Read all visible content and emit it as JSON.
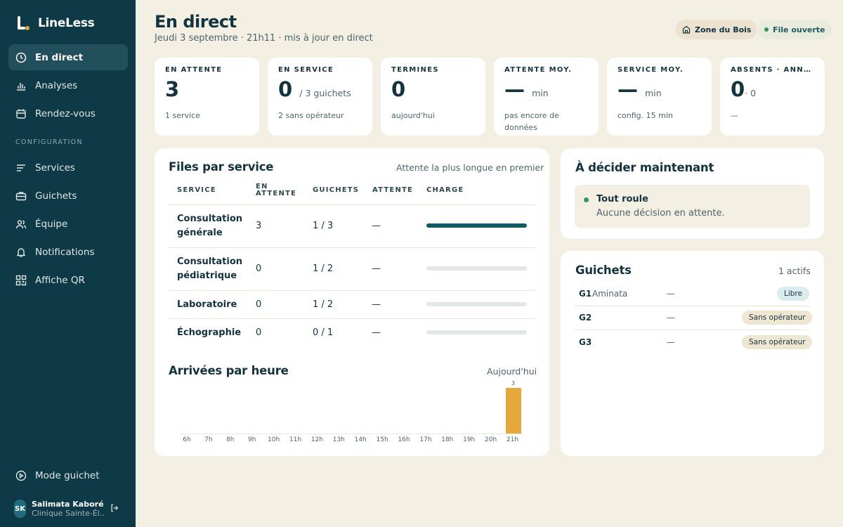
{
  "app": {
    "name": "LineLess"
  },
  "nav": {
    "items": [
      {
        "label": "En direct",
        "icon": "clock-icon"
      },
      {
        "label": "Analyses",
        "icon": "bar-chart-icon"
      },
      {
        "label": "Rendez-vous",
        "icon": "calendar-icon"
      }
    ],
    "section_label": "CONFIGURATION",
    "config_items": [
      {
        "label": "Services",
        "icon": "list-icon"
      },
      {
        "label": "Guichets",
        "icon": "briefcase-icon"
      },
      {
        "label": "Équipe",
        "icon": "users-icon"
      },
      {
        "label": "Notifications",
        "icon": "bell-icon"
      },
      {
        "label": "Affiche QR",
        "icon": "qr-icon"
      }
    ],
    "mode_label": "Mode guichet"
  },
  "user": {
    "initials": "SK",
    "name": "Salimata Kaboré",
    "org": "Clinique Sainte-Él…"
  },
  "header": {
    "title": "En direct",
    "subtitle": "Jeudi 3 septembre · 21h11 · mis à jour en direct",
    "zone_chip": "Zone du Bois",
    "status_chip": "File ouverte"
  },
  "stats": [
    {
      "label": "EN ATTENTE",
      "value": "3",
      "suffix": "",
      "note": "1 service"
    },
    {
      "label": "EN SERVICE",
      "value": "0",
      "suffix": "/ 3 guichets",
      "note": "2 sans opérateur"
    },
    {
      "label": "TERMINÉS",
      "value": "0",
      "suffix": "",
      "note": "aujourd'hui"
    },
    {
      "label": "ATTENTE MOY.",
      "value": "—",
      "suffix": "min",
      "note": "pas encore de données"
    },
    {
      "label": "SERVICE MOY.",
      "value": "—",
      "suffix": "min",
      "note": "config. 15 min"
    },
    {
      "label": "ABSENTS · ANNULÉS",
      "value": "0",
      "suffix": "· 0",
      "note": "—"
    }
  ],
  "queues": {
    "title": "Files par service",
    "sort_note": "Attente la plus longue en premier",
    "columns": [
      "SERVICE",
      "EN ATTENTE",
      "GUICHETS",
      "ATTENTE",
      "CHARGE"
    ],
    "rows": [
      {
        "service": "Consultation générale",
        "waiting": "3",
        "counters": "1 / 3",
        "wait": "—",
        "load": 1.0
      },
      {
        "service": "Consultation pédiatrique",
        "waiting": "0",
        "counters": "1 / 2",
        "wait": "—",
        "load": 0
      },
      {
        "service": "Laboratoire",
        "waiting": "0",
        "counters": "1 / 2",
        "wait": "—",
        "load": 0
      },
      {
        "service": "Échographie",
        "waiting": "0",
        "counters": "0 / 1",
        "wait": "—",
        "load": 0
      }
    ]
  },
  "arrivals": {
    "title": "Arrivées par heure",
    "meta": "Aujourd'hui"
  },
  "chart_data": {
    "type": "bar",
    "title": "Arrivées par heure",
    "categories": [
      "6h",
      "7h",
      "8h",
      "9h",
      "10h",
      "11h",
      "12h",
      "13h",
      "14h",
      "15h",
      "16h",
      "17h",
      "18h",
      "19h",
      "20h",
      "21h"
    ],
    "values": [
      0,
      0,
      0,
      0,
      0,
      0,
      0,
      0,
      0,
      0,
      0,
      0,
      0,
      0,
      0,
      3
    ],
    "ylim": [
      0,
      3
    ],
    "color": "#e4a93a"
  },
  "decide": {
    "title": "À décider maintenant",
    "status_title": "Tout roule",
    "status_text": "Aucune décision en attente."
  },
  "counters": {
    "title": "Guichets",
    "meta": "1 actifs",
    "rows": [
      {
        "id": "G1",
        "name": "Aminata",
        "dash": "—",
        "status": "Libre",
        "kind": "free"
      },
      {
        "id": "G2",
        "name": "",
        "dash": "—",
        "status": "Sans opérateur",
        "kind": "none"
      },
      {
        "id": "G3",
        "name": "",
        "dash": "—",
        "status": "Sans opérateur",
        "kind": "none"
      }
    ]
  }
}
